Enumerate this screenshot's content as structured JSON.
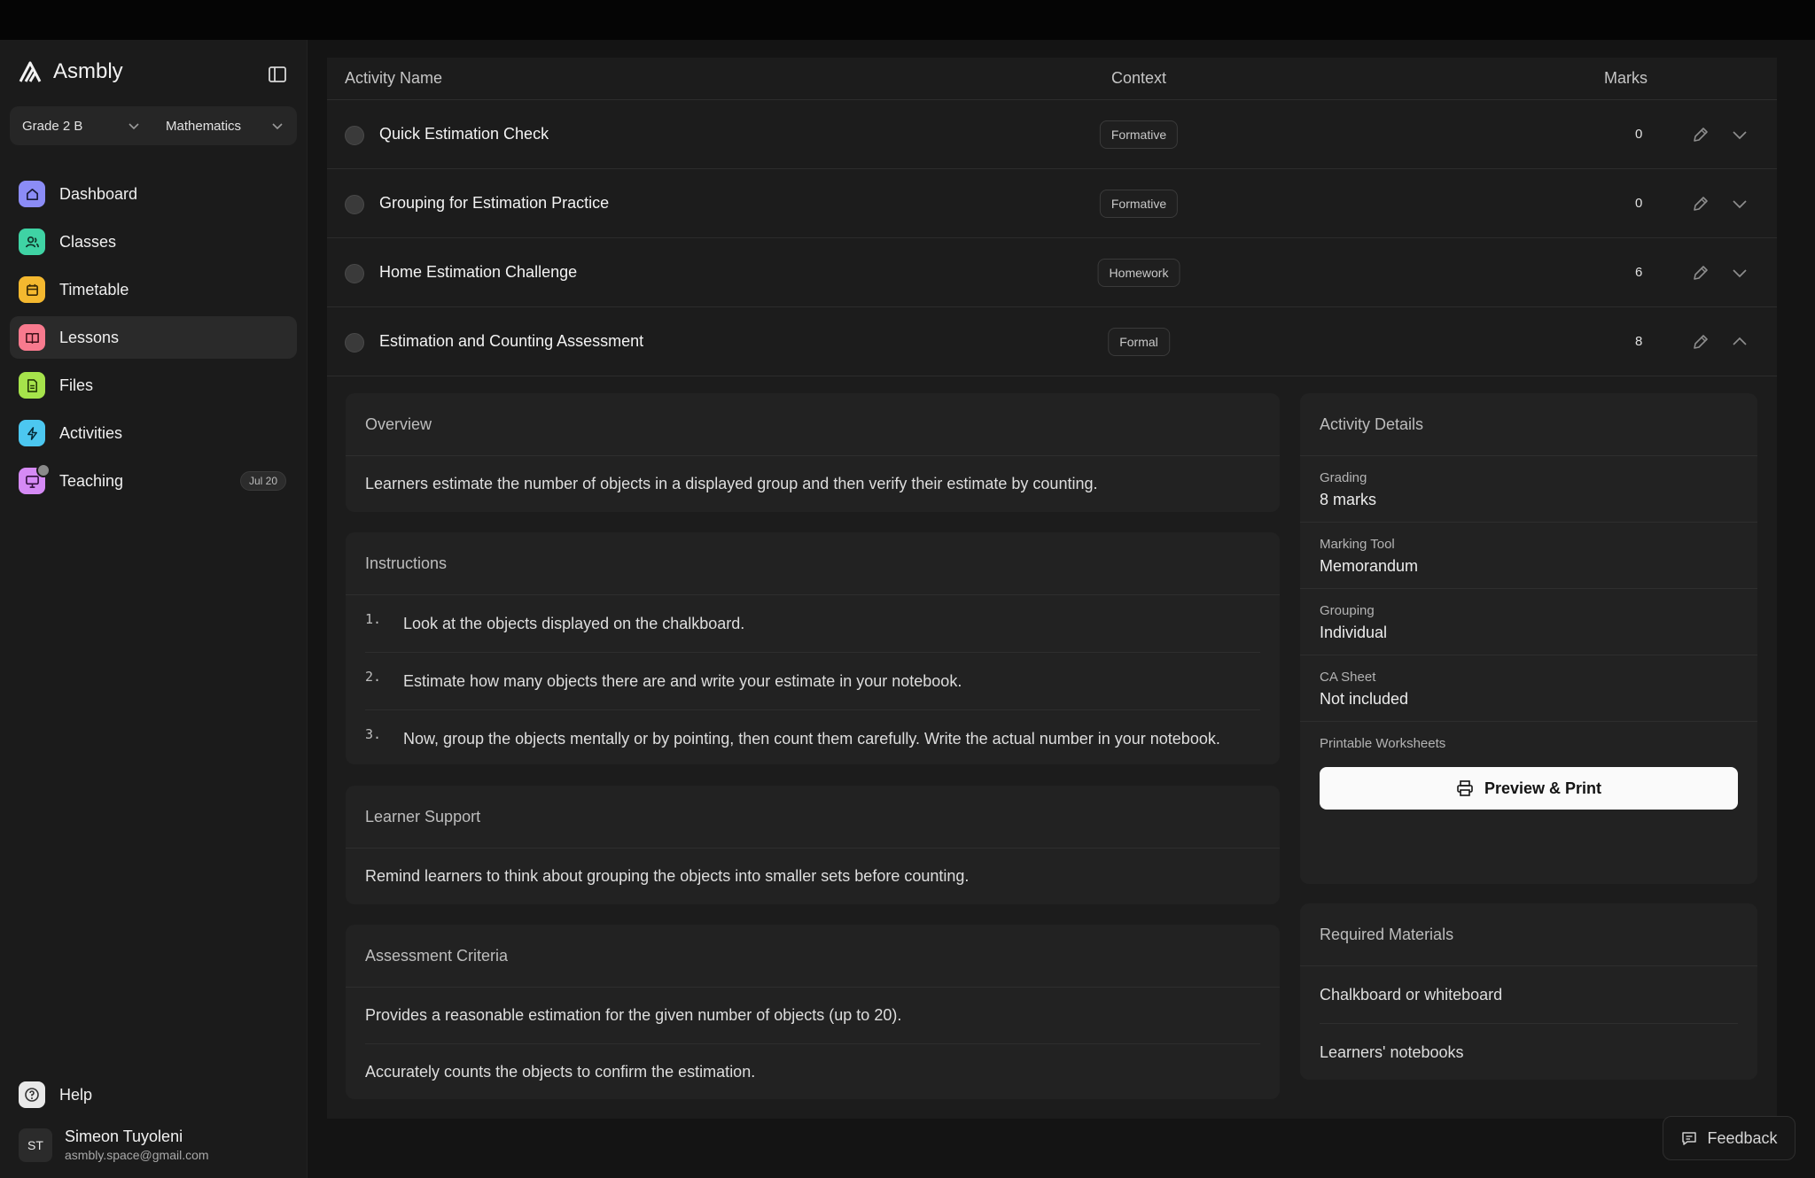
{
  "app": {
    "name": "Asmbly"
  },
  "selectors": {
    "grade": "Grade 2 B",
    "subject": "Mathematics"
  },
  "nav": [
    {
      "label": "Dashboard",
      "icon": "home-icon",
      "color": "#8b8cf6"
    },
    {
      "label": "Classes",
      "icon": "users-icon",
      "color": "#3fd3a4"
    },
    {
      "label": "Timetable",
      "icon": "calendar-icon",
      "color": "#f4b82f"
    },
    {
      "label": "Lessons",
      "icon": "book-icon",
      "color": "#f87a8e",
      "active": true
    },
    {
      "label": "Files",
      "icon": "file-icon",
      "color": "#a6e34b"
    },
    {
      "label": "Activities",
      "icon": "bolt-icon",
      "color": "#4cc7f0"
    },
    {
      "label": "Teaching",
      "icon": "presentation-icon",
      "color": "#d58af5",
      "badge": "Jul 20"
    }
  ],
  "help": {
    "label": "Help"
  },
  "user": {
    "initials": "ST",
    "name": "Simeon Tuyoleni",
    "email": "asmbly.space@gmail.com"
  },
  "table": {
    "headers": {
      "name": "Activity Name",
      "context": "Context",
      "marks": "Marks"
    },
    "rows": [
      {
        "name": "Quick Estimation Check",
        "context": "Formative",
        "marks": "0"
      },
      {
        "name": "Grouping for Estimation Practice",
        "context": "Formative",
        "marks": "0"
      },
      {
        "name": "Home Estimation Challenge",
        "context": "Homework",
        "marks": "6"
      },
      {
        "name": "Estimation and Counting Assessment",
        "context": "Formal",
        "marks": "8",
        "expanded": true
      }
    ]
  },
  "expanded": {
    "overview": {
      "title": "Overview",
      "text": "Learners estimate the number of objects in a displayed group and then verify their estimate by counting."
    },
    "instructions": {
      "title": "Instructions",
      "items": [
        {
          "num": "1.",
          "text": "Look at the objects displayed on the chalkboard."
        },
        {
          "num": "2.",
          "text": "Estimate how many objects there are and write your estimate in your notebook."
        },
        {
          "num": "3.",
          "text": "Now, group the objects mentally or by pointing, then count them carefully. Write the actual number in your notebook."
        }
      ]
    },
    "support": {
      "title": "Learner Support",
      "text": "Remind learners to think about grouping the objects into smaller sets before counting."
    },
    "criteria": {
      "title": "Assessment Criteria",
      "items": [
        "Provides a reasonable estimation for the given number of objects (up to 20).",
        "Accurately counts the objects to confirm the estimation."
      ]
    },
    "details": {
      "title": "Activity Details",
      "grading_label": "Grading",
      "grading_value": "8 marks",
      "tool_label": "Marking Tool",
      "tool_value": "Memorandum",
      "grouping_label": "Grouping",
      "grouping_value": "Individual",
      "ca_label": "CA Sheet",
      "ca_value": "Not included",
      "worksheets_label": "Printable Worksheets",
      "print_button": "Preview & Print"
    },
    "materials": {
      "title": "Required Materials",
      "items": [
        "Chalkboard or whiteboard",
        "Learners' notebooks"
      ]
    }
  },
  "feedback": {
    "label": "Feedback"
  }
}
